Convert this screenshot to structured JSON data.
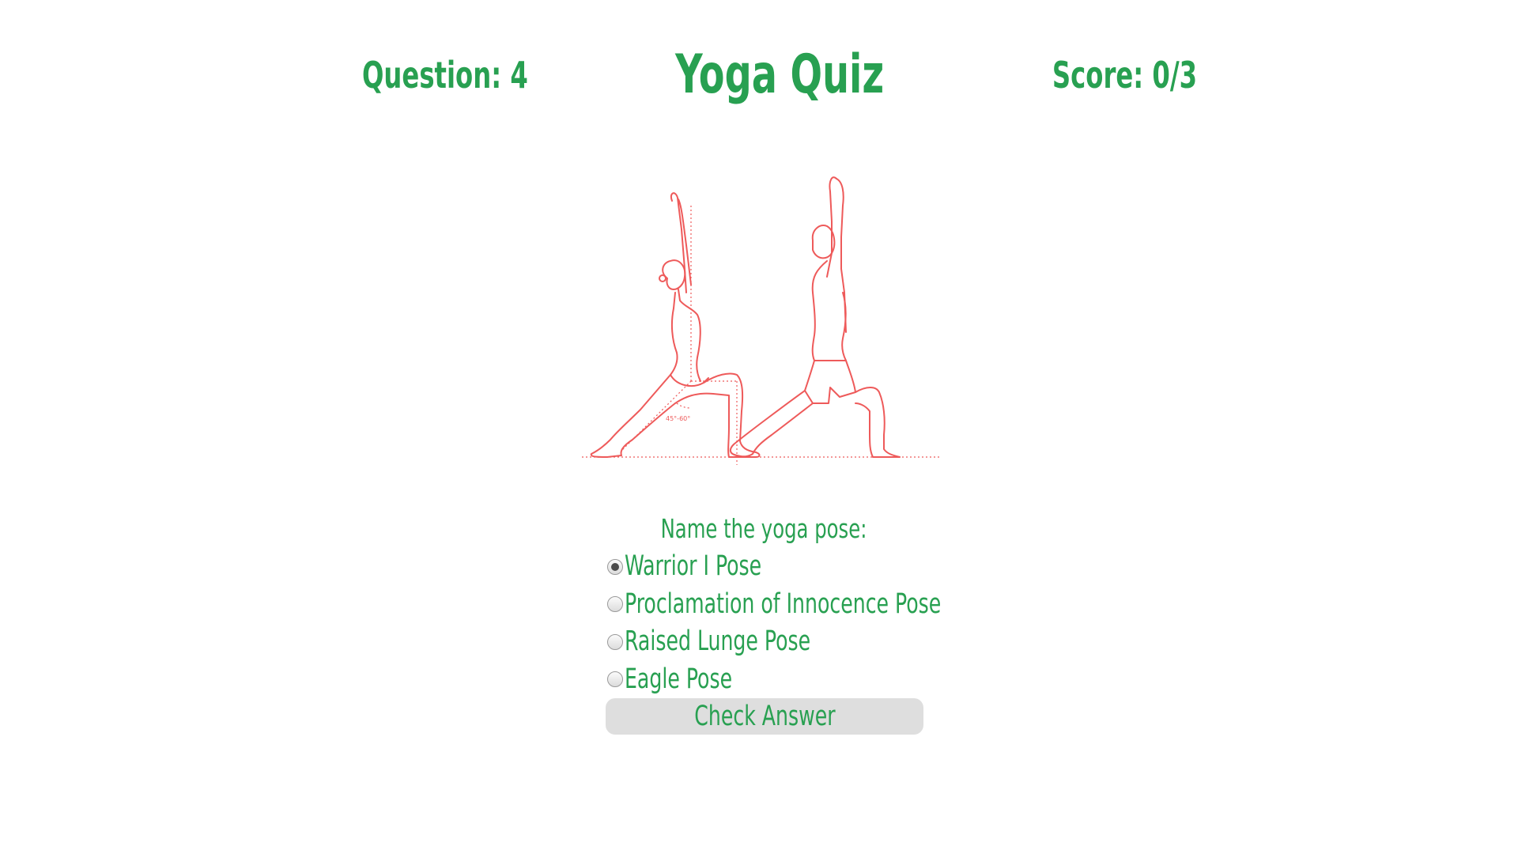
{
  "header": {
    "question_label": "Question: 4",
    "title": "Yoga Quiz",
    "score_label": "Score: 0/3"
  },
  "image": {
    "annotation": "45°-60°"
  },
  "quiz": {
    "prompt": "Name the yoga pose:",
    "options": [
      {
        "label": "Warrior I Pose",
        "selected": true
      },
      {
        "label": "Proclamation of Innocence Pose",
        "selected": false
      },
      {
        "label": "Raised Lunge Pose",
        "selected": false
      },
      {
        "label": "Eagle Pose",
        "selected": false
      }
    ],
    "check_button": "Check Answer"
  },
  "colors": {
    "accent_green": "#28a051",
    "illustration_red": "#ee5a5a",
    "button_bg": "#dedede"
  }
}
